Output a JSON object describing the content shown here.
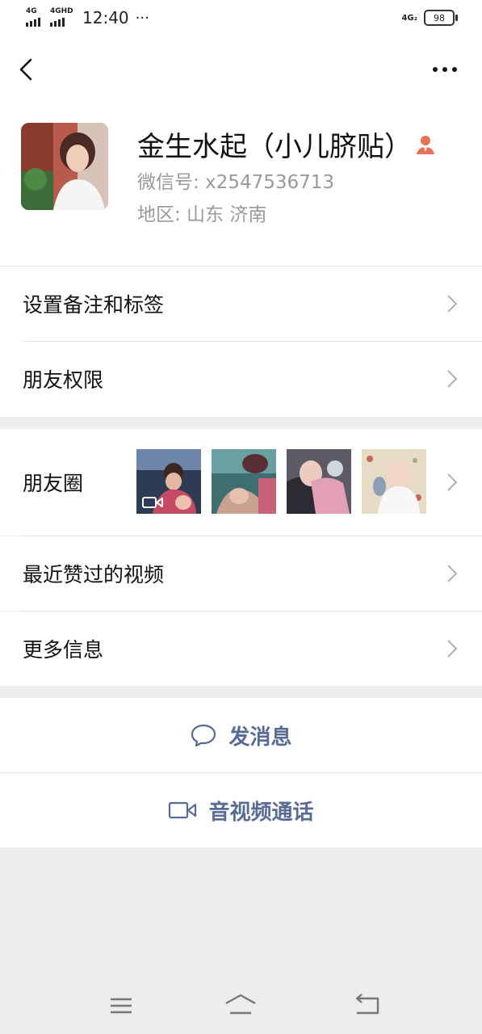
{
  "status_bar": {
    "sim1": "4G",
    "sim2": "4GHD",
    "time": "12:40",
    "more": "···",
    "net_right": "4G₂",
    "battery": "98"
  },
  "header": {
    "back_icon": "chevron-left-icon",
    "more_icon": "ellipsis-icon"
  },
  "profile": {
    "name": "金生水起（小儿脐贴）",
    "wechat_id": "微信号:  x2547536713",
    "region": "地区:  山东  济南",
    "badge_icon": "person-icon",
    "badge_color": "#e9705a"
  },
  "menu": {
    "remark_tags": "设置备注和标签",
    "friend_permissions": "朋友权限",
    "moments": "朋友圈",
    "recent_liked_videos": "最近赞过的视频",
    "more_info": "更多信息"
  },
  "actions": {
    "send_message": "发消息",
    "av_call": "音视频通话",
    "accent_color": "#576b95"
  }
}
